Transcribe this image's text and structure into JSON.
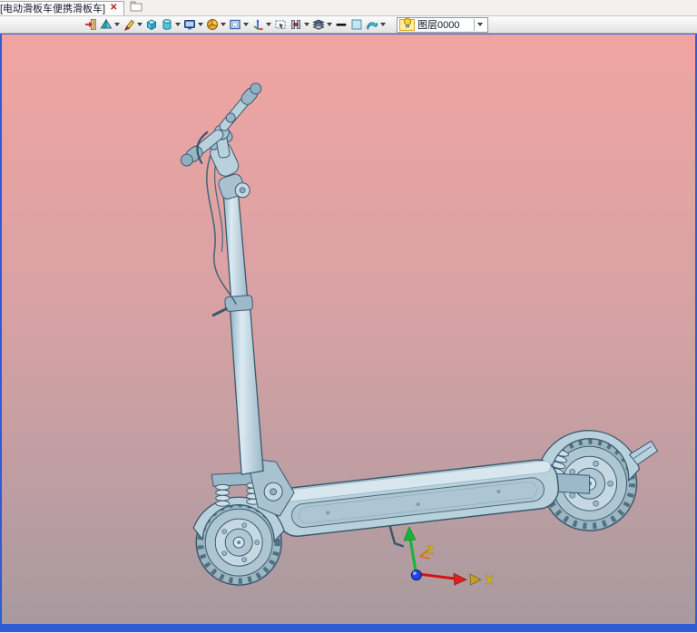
{
  "tab_bar": {
    "tab_title": "[电动滑板车便携滑板车]",
    "close_glyph": "✕"
  },
  "toolbar": {
    "buttons": [
      {
        "icon": "exit-icon",
        "dropdown": false
      },
      {
        "icon": "pyramid-icon",
        "dropdown": true
      },
      {
        "icon": "sketch-pencil-icon",
        "dropdown": true
      },
      {
        "icon": "cube-icon",
        "dropdown": false
      },
      {
        "icon": "cylinder-icon",
        "dropdown": true
      },
      {
        "icon": "monitor-icon",
        "dropdown": true
      },
      {
        "icon": "pie-sphere-icon",
        "dropdown": true
      },
      {
        "icon": "frame-icon",
        "dropdown": true
      },
      {
        "icon": "axes-icon",
        "dropdown": true
      },
      {
        "icon": "select-region-icon",
        "dropdown": false
      },
      {
        "icon": "section-beam-icon",
        "dropdown": true
      },
      {
        "icon": "layers-stack-icon",
        "dropdown": true
      },
      {
        "icon": "line-width-icon",
        "dropdown": false
      },
      {
        "icon": "color-swatch-icon",
        "dropdown": false
      },
      {
        "icon": "surface-sheet-icon",
        "dropdown": true
      }
    ],
    "layer_combo": {
      "bulb_icon": "lightbulb-icon",
      "value": "图层0000"
    }
  },
  "viewport": {
    "model": "electric-scooter-3d-model",
    "background_top": "#f0a4a2",
    "background_bottom": "#a89aa0",
    "frame_color": "#2f5bd6",
    "model_body_color": "#b9d0dd",
    "model_outline_color": "#3a5a6e",
    "triad": {
      "x_label": "X",
      "z_label": "Z",
      "x_axis_color": "#d41414",
      "z_axis_color": "#16b53a",
      "origin_color": "#2244e0",
      "label_color": "#e6c414"
    }
  }
}
